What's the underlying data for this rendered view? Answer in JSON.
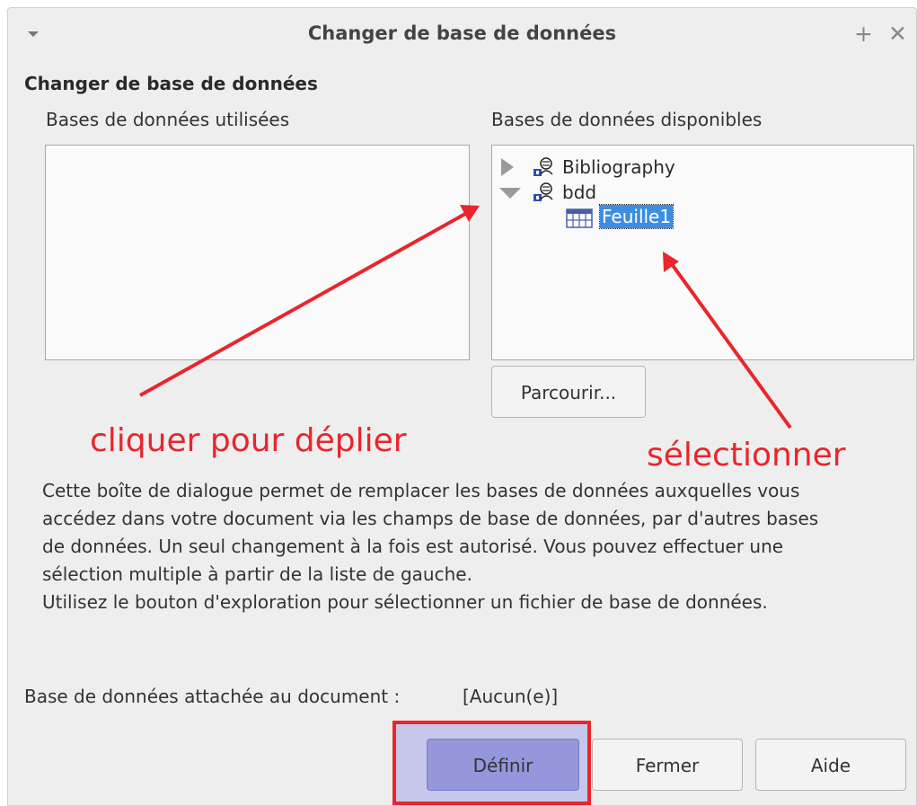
{
  "window": {
    "title": "Changer de base de données",
    "pin_symbol": "+",
    "close_symbol": "✕"
  },
  "section_title": "Changer de base de données",
  "used_databases": {
    "label": "Bases de données utilisées",
    "items": []
  },
  "available_databases": {
    "label": "Bases de données disponibles",
    "tree": [
      {
        "label": "Bibliography",
        "expanded": false,
        "icon": "database-icon"
      },
      {
        "label": "bdd",
        "expanded": true,
        "icon": "database-icon",
        "children": [
          {
            "label": "Feuille1",
            "icon": "table-icon",
            "selected": true
          }
        ]
      }
    ]
  },
  "buttons": {
    "browse": "Parcourir...",
    "define": "Définir",
    "close": "Fermer",
    "help": "Aide"
  },
  "description": {
    "line1": "Cette boîte de dialogue permet de remplacer les bases de données auxquelles vous",
    "line2": "accédez dans votre document via les champs de base de données, par d'autres bases",
    "line3": "de données. Un seul changement à la fois est autorisé. Vous pouvez effectuer une",
    "line4": "sélection multiple à partir de la liste de gauche.",
    "line5": "Utilisez le bouton d'exploration pour sélectionner un fichier de base de données."
  },
  "attached": {
    "label": "Base de données attachée au document :",
    "value": "[Aucun(e)]"
  },
  "annotations": {
    "expand_hint": "cliquer pour déplier",
    "select_hint": "sélectionner",
    "color": "#e8262b"
  },
  "colors": {
    "selection": "#3d8ee0",
    "define_highlight": "#9596dc"
  }
}
